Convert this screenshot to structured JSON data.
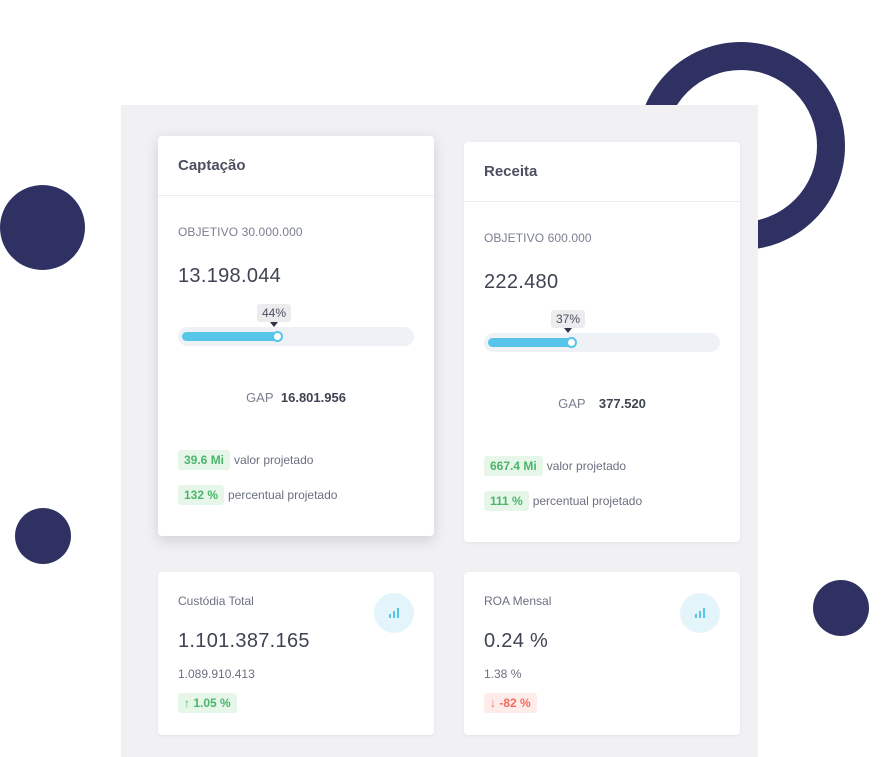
{
  "colors": {
    "accent": "#57c5ea",
    "decor": "#2e3161",
    "positive": "#4cb56a",
    "negative": "#ef6e5a"
  },
  "cards": [
    {
      "title": "Captação",
      "objective": "OBJETIVO 30.000.000",
      "value": "13.198.044",
      "progress_pct": 44,
      "progress_label": "44%",
      "gap_label": "GAP",
      "gap_value": "16.801.956",
      "projected_value": "39.6 Mi",
      "projected_value_label": "valor projetado",
      "projected_pct": "132 %",
      "projected_pct_label": "percentual projetado"
    },
    {
      "title": "Receita",
      "objective": "OBJETIVO 600.000",
      "value": "222.480",
      "progress_pct": 37,
      "progress_label": "37%",
      "gap_label": "GAP",
      "gap_value": "377.520",
      "projected_value": "667.4 Mi",
      "projected_value_label": "valor projetado",
      "projected_pct": "111 %",
      "projected_pct_label": "percentual projetado"
    }
  ],
  "metrics": [
    {
      "title": "Custódia Total",
      "value": "1.101.387.165",
      "sub": "1.089.910.413",
      "change": "1.05 %",
      "direction": "up",
      "icon": "bar-chart-icon"
    },
    {
      "title": "ROA Mensal",
      "value": "0.24 %",
      "sub": "1.38 %",
      "change": "-82 %",
      "direction": "down",
      "icon": "bar-chart-icon"
    }
  ]
}
